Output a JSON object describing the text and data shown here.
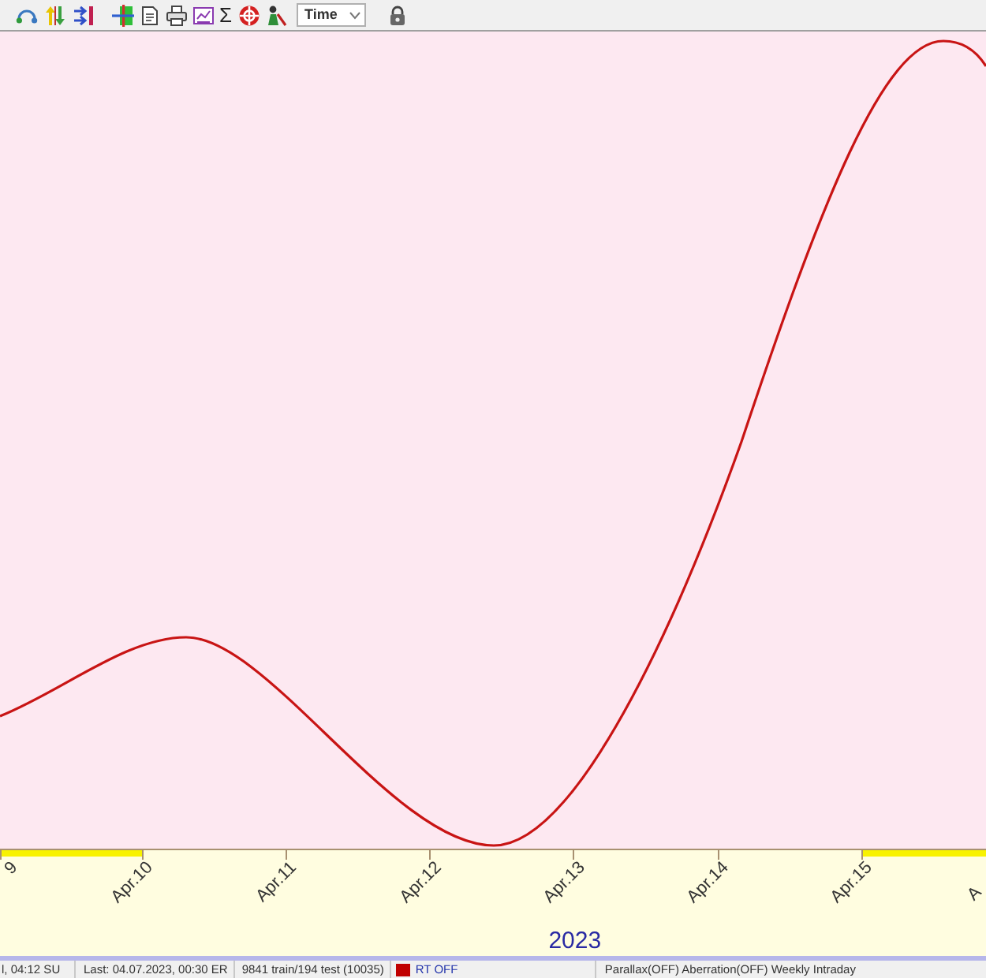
{
  "toolbar": {
    "sum_button": "Σ",
    "time_select": {
      "value": "Time"
    }
  },
  "x_axis": {
    "ticks": [
      "9",
      "Apr.10",
      "Apr.11",
      "Apr.12",
      "Apr.13",
      "Apr.14",
      "Apr.15",
      "A"
    ],
    "intervals": [
      {
        "highlighted": true
      },
      {
        "highlighted": false
      },
      {
        "highlighted": false
      },
      {
        "highlighted": false
      },
      {
        "highlighted": false
      },
      {
        "highlighted": false
      },
      {
        "highlighted": true
      }
    ],
    "year": "2023"
  },
  "status_bar": {
    "fields": [
      "l, 04:12 SU",
      "Last: 04.07.2023, 00:30 ER",
      "9841 train/194 test (10035)"
    ],
    "rt_status": "RT OFF",
    "flags": "Parallax(OFF) Aberration(OFF) Weekly Intraday"
  }
}
